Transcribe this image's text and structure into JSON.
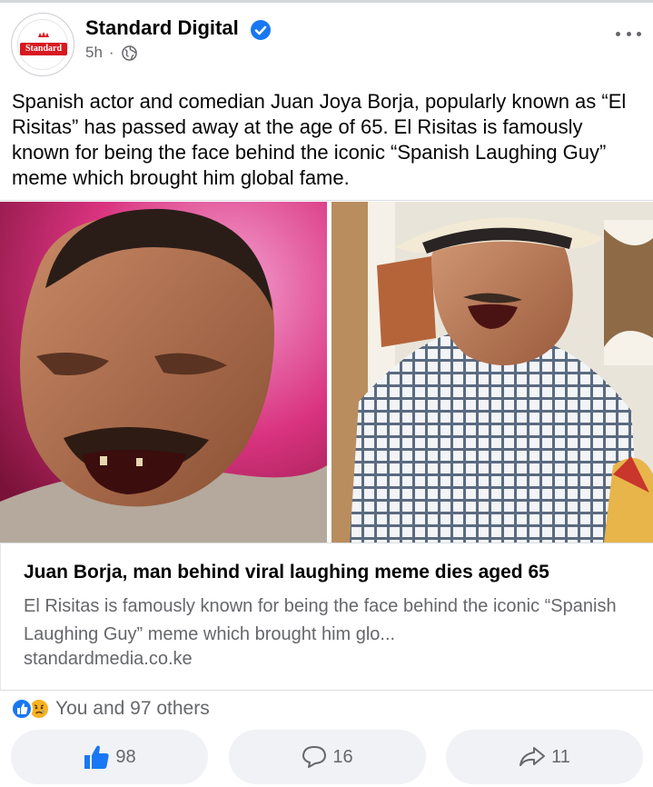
{
  "post": {
    "page_name": "Standard Digital",
    "avatar_logo_text": "Standard",
    "time_ago": "5h",
    "separator": "·",
    "text": "Spanish actor and comedian Juan Joya Borja, popularly known as “El Risitas” has passed away at the age of 65. El Risitas is famously known for being the face behind the iconic “Spanish Laughing Guy” meme which brought him global fame."
  },
  "link_preview": {
    "title": "Juan Borja, man behind viral laughing meme dies aged 65",
    "description": "El Risitas is famously known for being the face behind the iconic “Spanish Laughing Guy” meme which brought him glo...",
    "domain": "standardmedia.co.ke"
  },
  "reactions": {
    "summary": "You and 97 others",
    "icons": [
      "like-reaction-icon",
      "sad-reaction-icon"
    ]
  },
  "actions": {
    "like_count": "98",
    "comment_count": "16",
    "share_count": "11"
  },
  "colors": {
    "accent_blue": "#1877f2",
    "secondary_text": "#65676b",
    "button_bg": "#f0f2f5",
    "logo_red": "#d71920"
  }
}
